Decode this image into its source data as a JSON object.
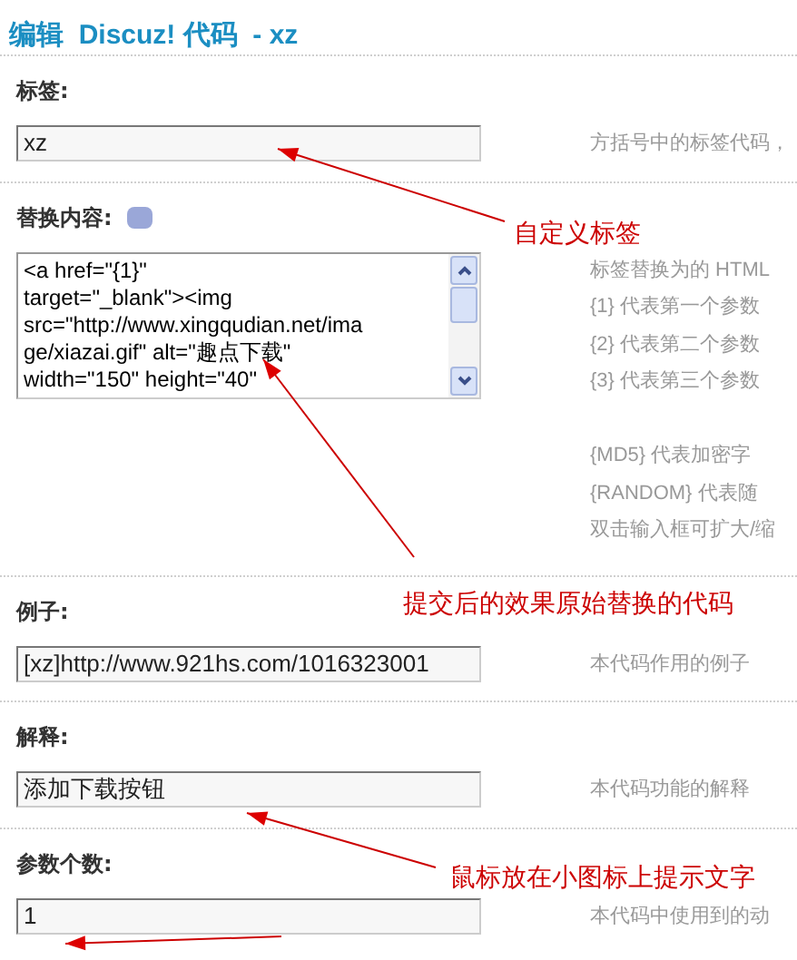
{
  "title": "编辑  Discuz! 代码  - xz",
  "sections": [
    {
      "label": "标签:",
      "kind": "input",
      "value": "xz",
      "hints": [
        "方括号中的标签代码，"
      ]
    },
    {
      "label": "替换内容:",
      "kind": "textarea",
      "help_icon": true,
      "value": "<a href=\"{1}\"\ntarget=\"_blank\"><img\nsrc=\"http://www.xingqudian.net/ima\nge/xiazai.gif\" alt=\"趣点下载\"\nwidth=\"150\" height=\"40\"",
      "hints": [
        "标签替换为的 HTML",
        "{1} 代表第一个参数",
        "{2} 代表第二个参数",
        "{3} 代表第三个参数"
      ],
      "more_hints": [
        "{MD5} 代表加密字",
        "{RANDOM} 代表随",
        "双击输入框可扩大/缩"
      ]
    },
    {
      "label": "例子:",
      "kind": "input",
      "value": "[xz]http://www.921hs.com/1016323001",
      "hints": [
        "本代码作用的例子"
      ]
    },
    {
      "label": "解释:",
      "kind": "input",
      "value": "添加下载按钮",
      "hints": [
        "本代码功能的解释"
      ]
    },
    {
      "label": "参数个数:",
      "kind": "input",
      "value": "1",
      "hints": [
        "本代码中使用到的动"
      ]
    }
  ],
  "annotations": [
    "自定义标签",
    "提交后的效果原始替换的代码",
    "鼠标放在小图标上提示文字"
  ]
}
